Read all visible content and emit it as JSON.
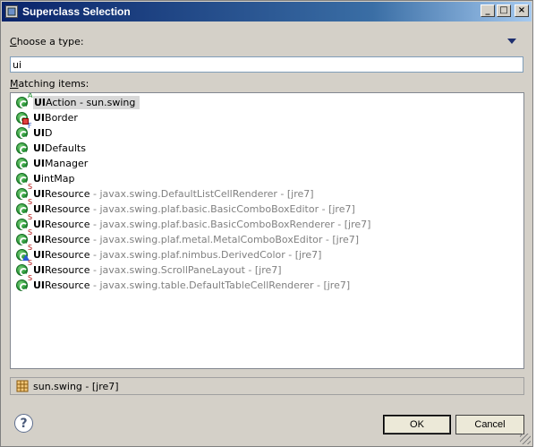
{
  "window": {
    "title": "Superclass Selection"
  },
  "labels": {
    "choose_type_prefix": "C",
    "choose_type_rest": "hoose a type:",
    "matching_prefix": "M",
    "matching_rest": "atching items:"
  },
  "filter": {
    "value": "ui"
  },
  "items": [
    {
      "bold": "UI",
      "rest": "Action",
      "qualifier": " - sun.swing",
      "modifier": "A",
      "overlay": "",
      "selected": true
    },
    {
      "bold": "UI",
      "rest": "Border",
      "qualifier": "",
      "modifier": "",
      "overlay": "red",
      "selected": false
    },
    {
      "bold": "UI",
      "rest": "D",
      "qualifier": "",
      "modifier": "F",
      "overlay": "",
      "selected": false
    },
    {
      "bold": "UI",
      "rest": "Defaults",
      "qualifier": "",
      "modifier": "",
      "overlay": "",
      "selected": false
    },
    {
      "bold": "UI",
      "rest": "Manager",
      "qualifier": "",
      "modifier": "",
      "overlay": "",
      "selected": false
    },
    {
      "bold": "U",
      "rest": "intMap",
      "qualifier": "",
      "modifier": "",
      "overlay": "",
      "selected": false
    },
    {
      "bold": "UI",
      "rest": "Resource",
      "qualifier": " - javax.swing.DefaultListCellRenderer - [jre7]",
      "modifier": "S",
      "overlay": "",
      "selected": false
    },
    {
      "bold": "UI",
      "rest": "Resource",
      "qualifier": " - javax.swing.plaf.basic.BasicComboBoxEditor - [jre7]",
      "modifier": "S",
      "overlay": "",
      "selected": false
    },
    {
      "bold": "UI",
      "rest": "Resource",
      "qualifier": " - javax.swing.plaf.basic.BasicComboBoxRenderer - [jre7]",
      "modifier": "S",
      "overlay": "",
      "selected": false
    },
    {
      "bold": "UI",
      "rest": "Resource",
      "qualifier": " - javax.swing.plaf.metal.MetalComboBoxEditor - [jre7]",
      "modifier": "S",
      "overlay": "",
      "selected": false
    },
    {
      "bold": "UI",
      "rest": "Resource",
      "qualifier": " - javax.swing.plaf.nimbus.DerivedColor - [jre7]",
      "modifier": "S",
      "overlay": "blue",
      "selected": false
    },
    {
      "bold": "UI",
      "rest": "Resource",
      "qualifier": " - javax.swing.ScrollPaneLayout - [jre7]",
      "modifier": "S",
      "overlay": "",
      "selected": false
    },
    {
      "bold": "UI",
      "rest": "Resource",
      "qualifier": " - javax.swing.table.DefaultTableCellRenderer - [jre7]",
      "modifier": "S",
      "overlay": "",
      "selected": false
    }
  ],
  "status": {
    "text": "sun.swing - [jre7]"
  },
  "buttons": {
    "help": "?",
    "ok": "OK",
    "cancel": "Cancel"
  },
  "titlebar_buttons": {
    "minimize": "_",
    "maximize": "□",
    "close": "×"
  }
}
